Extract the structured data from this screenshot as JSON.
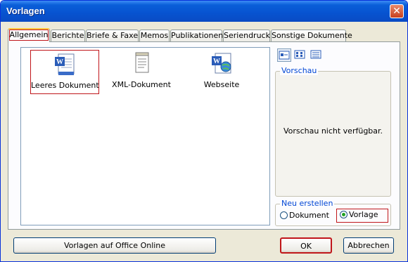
{
  "window": {
    "title": "Vorlagen",
    "close_glyph": "✕"
  },
  "tabs": [
    {
      "label": "Allgemein"
    },
    {
      "label": "Berichte"
    },
    {
      "label": "Briefe & Faxe"
    },
    {
      "label": "Memos"
    },
    {
      "label": "Publikationen"
    },
    {
      "label": "Seriendruck"
    },
    {
      "label": "Sonstige Dokumente"
    }
  ],
  "templates": [
    {
      "label": "Leeres Dokument",
      "icon": "word-document-icon"
    },
    {
      "label": "XML-Dokument",
      "icon": "xml-document-icon"
    },
    {
      "label": "Webseite",
      "icon": "web-page-icon"
    }
  ],
  "preview": {
    "legend": "Vorschau",
    "message": "Vorschau nicht verfügbar."
  },
  "new_group": {
    "legend": "Neu erstellen",
    "option_document": "Dokument",
    "option_template": "Vorlage",
    "selected": "Vorlage"
  },
  "buttons": {
    "office_online": "Vorlagen auf Office Online",
    "ok": "OK",
    "cancel": "Abbrechen"
  },
  "colors": {
    "titlebar": "#0a5fd8",
    "accent_border": "#c0161a",
    "legend_text": "#0046d5",
    "dialog_bg": "#ece9d8"
  }
}
